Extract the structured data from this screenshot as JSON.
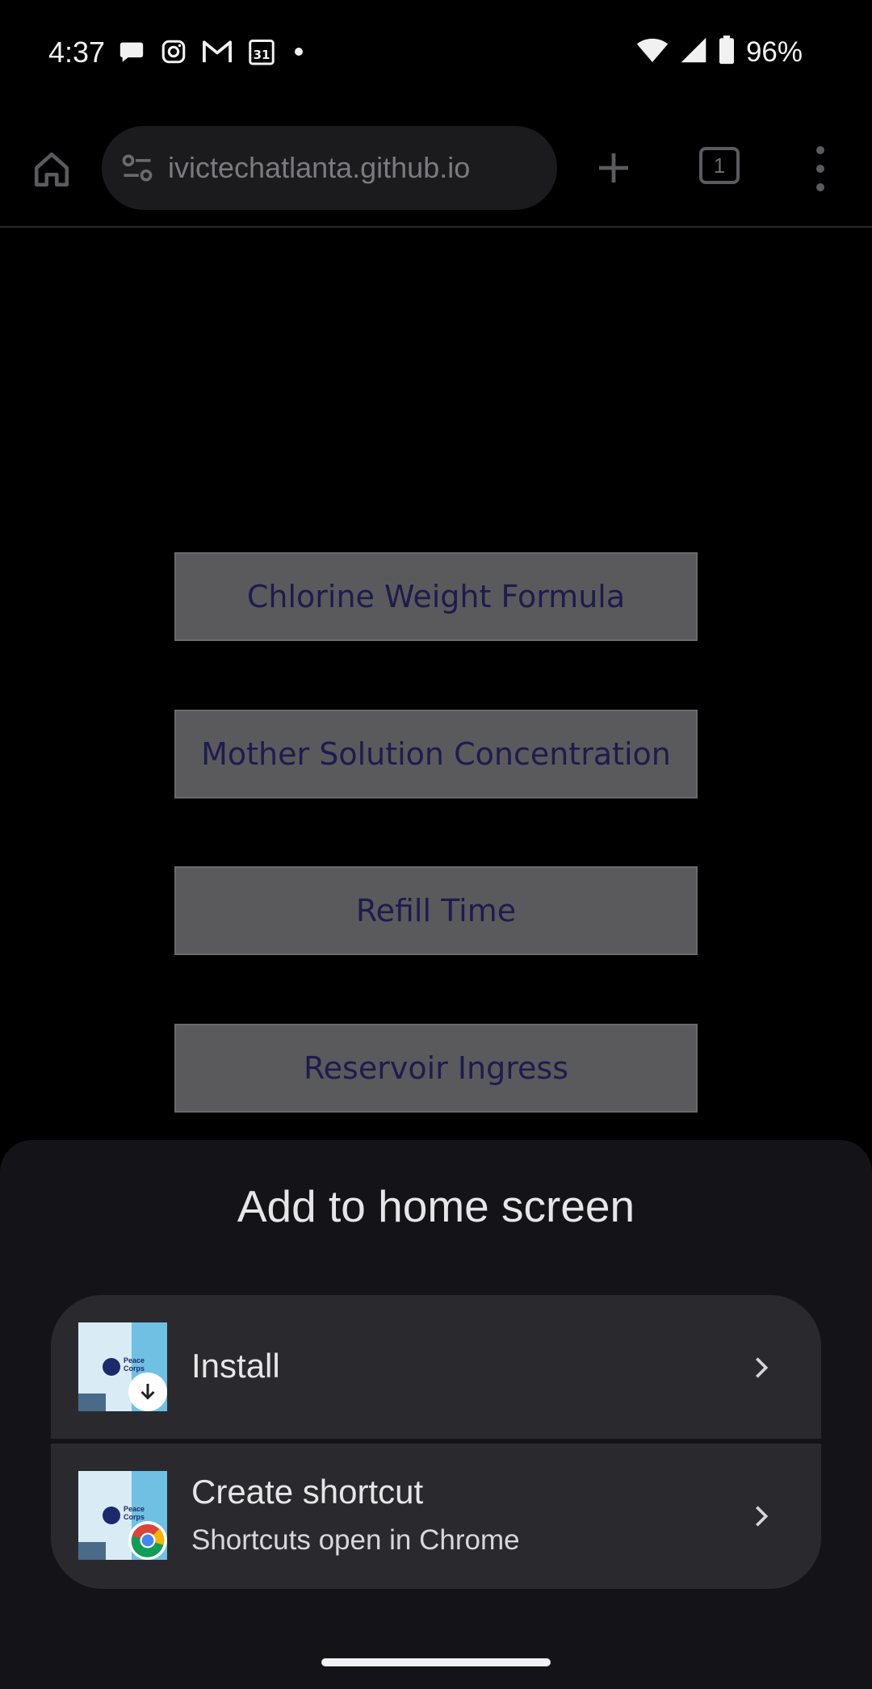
{
  "status_bar": {
    "time": "4:37",
    "battery_percent": "96%",
    "left_icons": [
      "chat-icon",
      "instagram-icon",
      "gmail-icon",
      "calendar-icon",
      "dot-icon"
    ],
    "calendar_day": "31",
    "right_icons": [
      "wifi-icon",
      "cell-signal-icon",
      "battery-icon"
    ]
  },
  "browser": {
    "url": "ivictechatlanta.github.io",
    "tab_count": "1",
    "icons": [
      "home-icon",
      "site-settings-icon",
      "new-tab-icon",
      "tab-switcher-icon",
      "more-options-icon"
    ]
  },
  "page": {
    "buttons": [
      {
        "label": "Chlorine Weight Formula"
      },
      {
        "label": "Mother Solution Concentration"
      },
      {
        "label": "Refill Time"
      },
      {
        "label": "Reservoir Ingress"
      }
    ]
  },
  "sheet": {
    "title": "Add to home screen",
    "options": [
      {
        "title": "Install",
        "subtitle": "",
        "badge": "download-icon"
      },
      {
        "title": "Create shortcut",
        "subtitle": "Shortcuts open in Chrome",
        "badge": "chrome-icon"
      }
    ],
    "thumbnail_logo_text": "Peace Corps"
  },
  "colors": {
    "background": "#000000",
    "page_button_bg": "#5a5a5c",
    "page_button_text": "#1e1b4e",
    "sheet_bg": "#141418",
    "card_bg": "#2a2a2e"
  }
}
